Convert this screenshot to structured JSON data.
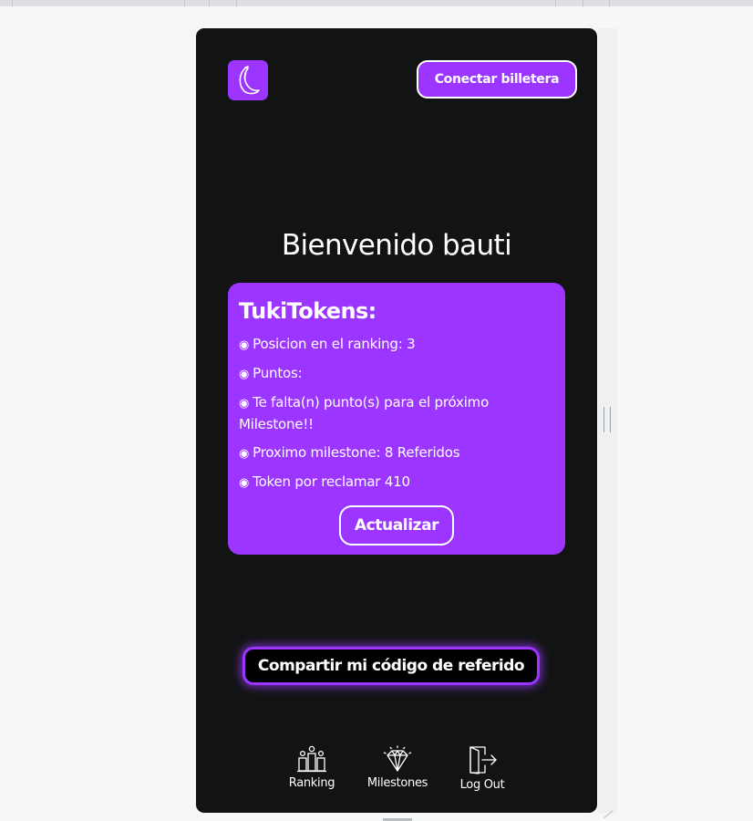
{
  "header": {
    "logo_icon": "banana-icon",
    "wallet_button": "Conectar billetera"
  },
  "welcome": "Bienvenido bauti",
  "card": {
    "title": "TukiTokens:",
    "bullet": "◉",
    "stats": [
      "Posicion en el ranking: 3",
      "Puntos:",
      "Te falta(n) punto(s) para el próximo Milestone!!",
      "Proximo milestone: 8 Referidos",
      "Token por reclamar 410"
    ],
    "refresh_button": "Actualizar"
  },
  "share_button": "Compartir mi código de referido",
  "nav": [
    {
      "label": "Ranking",
      "icon": "ranking-icon"
    },
    {
      "label": "Milestones",
      "icon": "diamond-icon"
    },
    {
      "label": "Log Out",
      "icon": "logout-icon"
    }
  ],
  "colors": {
    "accent": "#9b35ff",
    "phone_background": "#121414",
    "page_background": "#f6f7f7"
  }
}
